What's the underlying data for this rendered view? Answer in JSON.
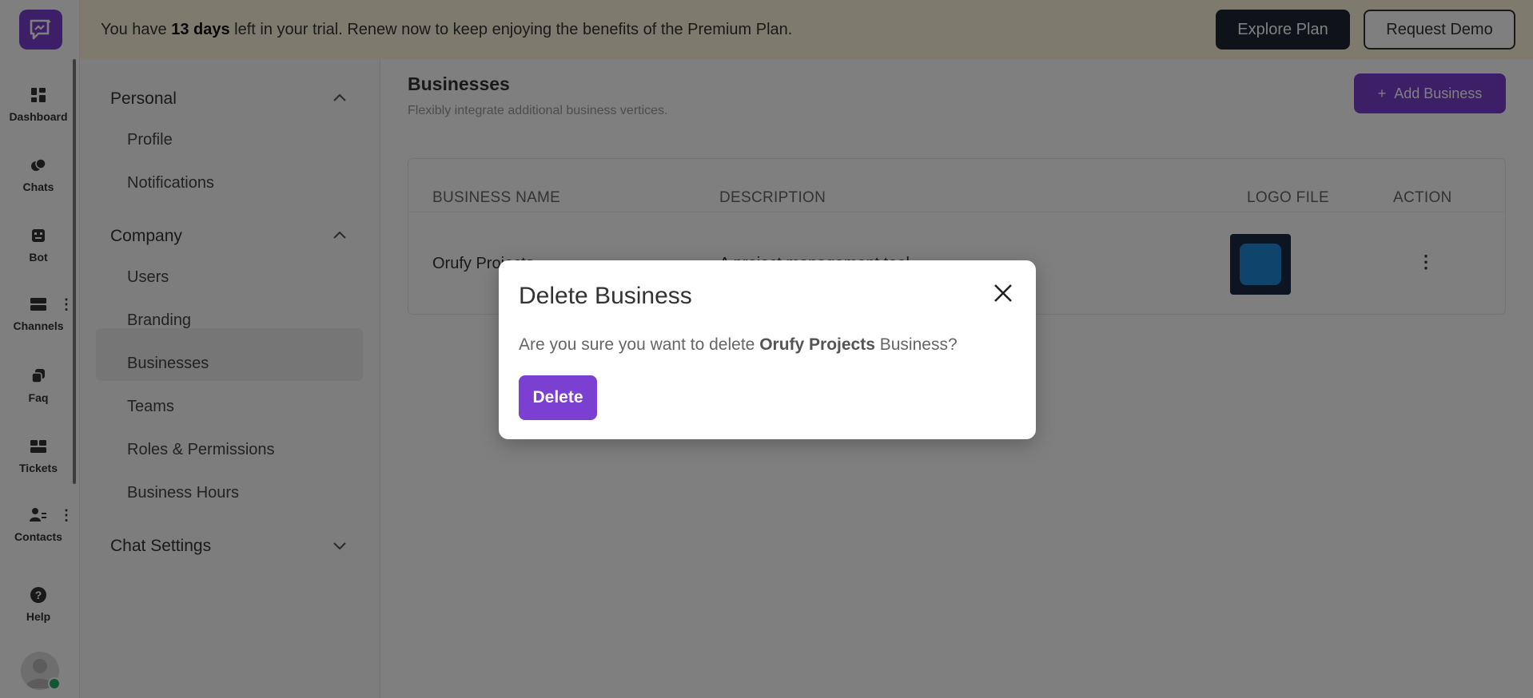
{
  "banner": {
    "text_before": "You have ",
    "days": "13 days",
    "text_after": " left in your trial. Renew now to keep enjoying the benefits of the Premium Plan.",
    "explore_label": "Explore Plan",
    "demo_label": "Request Demo"
  },
  "rail": {
    "items": [
      {
        "label": "Dashboard",
        "icon": "grid-icon"
      },
      {
        "label": "Chats",
        "icon": "chat-icon"
      },
      {
        "label": "Bot",
        "icon": "bot-icon"
      },
      {
        "label": "Channels",
        "icon": "channels-icon"
      },
      {
        "label": "Faq",
        "icon": "faq-icon"
      },
      {
        "label": "Tickets",
        "icon": "tickets-icon"
      },
      {
        "label": "Contacts",
        "icon": "contacts-icon"
      },
      {
        "label": "Help",
        "icon": "help-icon"
      }
    ]
  },
  "settings": {
    "sections": [
      {
        "title": "Personal",
        "items": [
          "Profile",
          "Notifications"
        ]
      },
      {
        "title": "Company",
        "items": [
          "Users",
          "Branding",
          "Businesses",
          "Teams",
          "Roles & Permissions",
          "Business Hours"
        ]
      },
      {
        "title": "Chat Settings",
        "items": []
      }
    ],
    "active_item": "Businesses"
  },
  "main": {
    "title": "Businesses",
    "subtitle": "Flexibly integrate additional business vertices.",
    "add_label": "Add Business",
    "table": {
      "headers": [
        "BUSINESS NAME",
        "DESCRIPTION",
        "LOGO FILE",
        "ACTION"
      ],
      "rows": [
        {
          "name": "Orufy Projects",
          "description": "A project management tool"
        }
      ]
    }
  },
  "modal": {
    "title": "Delete Business",
    "msg_before": "Are you sure you want to delete ",
    "msg_name": "Orufy Projects",
    "msg_after": " Business?",
    "delete_label": "Delete"
  },
  "colors": {
    "accent": "#7b3fd1",
    "banner_bg": "#fdf7dc",
    "dark_button": "#1f2433"
  }
}
